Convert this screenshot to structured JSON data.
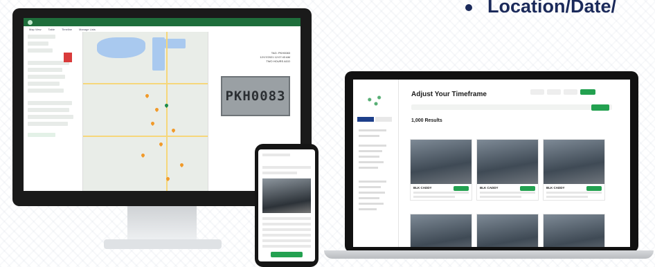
{
  "headline": {
    "bullet": "•",
    "text": "Location/Date/"
  },
  "monitor": {
    "tabs": [
      "Map View",
      "Table",
      "Timeline",
      "Manage Lists"
    ],
    "plate_text": "PKH0083",
    "meta_lines": [
      "TAG: PKH0083",
      "12/17/2021 12:07:43 AM",
      "TWO HOURS AGO"
    ]
  },
  "laptop": {
    "title": "Adjust Your Timeframe",
    "results": "1,000 Results",
    "cards": [
      {
        "title": "BLK CADDY"
      },
      {
        "title": "BLK CADDY"
      },
      {
        "title": "BLK CADDY"
      }
    ]
  },
  "colors": {
    "brand": "#1e6e3b",
    "accent": "#23a150",
    "headline": "#1b2a5a"
  },
  "icons": [
    "logo-icon",
    "map-pin-icon",
    "car-photo-icon",
    "plate-photo-icon"
  ]
}
